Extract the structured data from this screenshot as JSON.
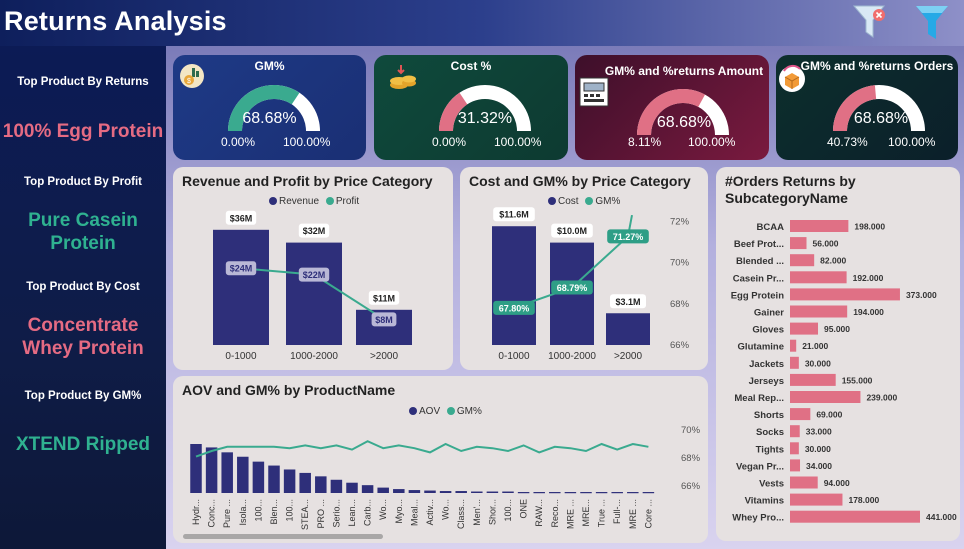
{
  "header": {
    "title": "Returns Analysis"
  },
  "sidebar": {
    "items": [
      {
        "label": "Top Product By Returns",
        "value": "100% Egg Protein",
        "color": "#e56b83"
      },
      {
        "label": "Top Product By Profit",
        "value": "Pure Casein Protein",
        "color": "#2fb190"
      },
      {
        "label": "Top Product By Cost",
        "value": "Concentrate Whey Protein",
        "color": "#e56b83"
      },
      {
        "label": "Top Product By GM%",
        "value": "XTEND Ripped",
        "color": "#2fb190"
      }
    ]
  },
  "kpis": [
    {
      "title": "GM%",
      "value": "68.68%",
      "min": "0.00%",
      "max": "100.00%",
      "fraction": 0.6868,
      "fill": "#3aaa8f",
      "icon": "money-chart-icon"
    },
    {
      "title": "Cost %",
      "value": "31.32%",
      "min": "0.00%",
      "max": "100.00%",
      "fraction": 0.3132,
      "fill": "#e07085",
      "icon": "coins-icon"
    },
    {
      "title": "GM% and %returns Amount",
      "value": "68.68%",
      "min": "8.11%",
      "max": "100.00%",
      "fraction": 0.6587,
      "fill": "#e07085",
      "icon": "cash-register-icon"
    },
    {
      "title": "GM% and %returns Orders",
      "value": "68.68%",
      "min": "40.73%",
      "max": "100.00%",
      "fraction": 0.4716,
      "fill": "#e07085",
      "icon": "return-box-icon"
    }
  ],
  "colors": {
    "navy": "#2e2f7a",
    "teal": "#3aaa8f",
    "pink": "#e07085"
  },
  "chart_data": [
    {
      "type": "bar",
      "title": "Revenue and Profit by Price Category",
      "categories": [
        "0-1000",
        "1000-2000",
        ">2000"
      ],
      "series": [
        {
          "name": "Revenue",
          "values": [
            36,
            32,
            11
          ],
          "labels": [
            "$36M",
            "$32M",
            "$11M"
          ]
        },
        {
          "name": "Profit",
          "values": [
            24,
            22,
            8
          ],
          "labels": [
            "$24M",
            "$22M",
            "$8M"
          ]
        }
      ],
      "ylim": [
        0,
        40
      ]
    },
    {
      "type": "bar",
      "title": "Cost and GM% by Price Category",
      "categories": [
        "0-1000",
        "1000-2000",
        ">2000"
      ],
      "series": [
        {
          "name": "Cost",
          "values": [
            11.6,
            10.0,
            3.1
          ],
          "labels": [
            "$11.6M",
            "$10.0M",
            "$3.1M"
          ]
        },
        {
          "name": "GM%",
          "values": [
            67.8,
            68.79,
            71.27
          ],
          "labels": [
            "67.80%",
            "68.79%",
            "71.27%"
          ]
        }
      ],
      "y2_ticks": [
        "72%",
        "70%",
        "68%",
        "66%"
      ],
      "y2lim": [
        66,
        72.5
      ]
    },
    {
      "type": "bar",
      "title": "AOV and GM% by ProductName",
      "categories": [
        "Hydr...",
        "Conc...",
        "Pure ...",
        "Isola...",
        "100...",
        "Blen...",
        "100...",
        "STEA...",
        "PRO ...",
        "Serio...",
        "Lean...",
        "Carb...",
        "Wo...",
        "Myo...",
        "Meal...",
        "Activ...",
        "Wo...",
        "Class...",
        "Men'...",
        "Shor...",
        "100...",
        "ONE",
        "RAW...",
        "Reco...",
        "MRE ...",
        "MRE...",
        "True ...",
        "Full-...",
        "MRE ...",
        "Core ..."
      ],
      "series": [
        {
          "name": "AOV",
          "values": [
            100,
            93,
            83,
            74,
            64,
            56,
            48,
            41,
            34,
            27,
            21,
            16,
            11,
            8,
            6,
            5,
            4,
            4,
            3,
            3,
            3,
            2,
            2,
            2,
            2,
            2,
            2,
            2,
            2,
            2
          ]
        },
        {
          "name": "GM%",
          "values": [
            68.1,
            68.5,
            68.8,
            68.8,
            68.8,
            68.8,
            68.7,
            68.9,
            68.7,
            68.9,
            68.6,
            69.2,
            68.7,
            68.9,
            68.7,
            68.4,
            69.0,
            68.5,
            68.8,
            68.7,
            68.5,
            68.9,
            68.4,
            68.8,
            68.7,
            68.5,
            69.0,
            68.6,
            69.0,
            68.8
          ]
        }
      ],
      "y2_ticks": [
        "70%",
        "68%",
        "66%"
      ],
      "y2lim": [
        65.5,
        70.5
      ]
    },
    {
      "type": "bar",
      "title": "#Orders Returns by SubcategoryName",
      "categories": [
        "BCAA",
        "Beef Prot...",
        "Blended ...",
        "Casein Pr...",
        "Egg Protein",
        "Gainer",
        "Gloves",
        "Glutamine",
        "Jackets",
        "Jerseys",
        "Meal Rep...",
        "Shorts",
        "Socks",
        "Tights",
        "Vegan Pr...",
        "Vests",
        "Vitamins",
        "Whey Pro..."
      ],
      "values": [
        198,
        56,
        82,
        192,
        373,
        194,
        95,
        21,
        30,
        155,
        239,
        69,
        33,
        30,
        34,
        94,
        178,
        441
      ],
      "labels": [
        "198.000",
        "56.000",
        "82.000",
        "192.000",
        "373.000",
        "194.000",
        "95.000",
        "21.000",
        "30.000",
        "155.000",
        "239.000",
        "69.000",
        "33.000",
        "30.000",
        "34.000",
        "94.000",
        "178.000",
        "441.000"
      ]
    }
  ]
}
